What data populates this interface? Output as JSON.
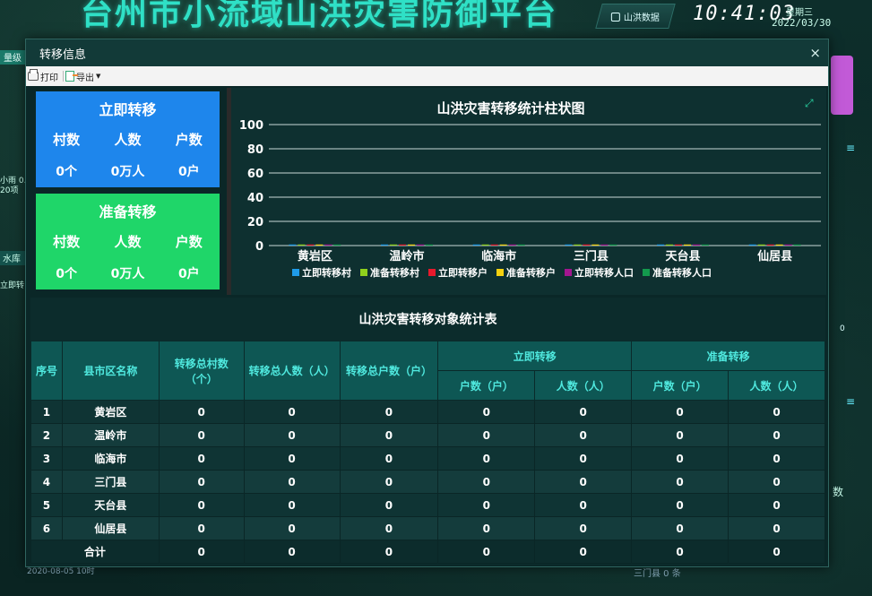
{
  "background": {
    "title": "台州市小流域山洪灾害防御平台",
    "data_tab": "山洪数据",
    "time": "10:41:03",
    "weekday": "星期三",
    "date": "2022/03/30",
    "left_tab_1": "量级",
    "left_text_line1": "小雨 0.",
    "left_text_line2": "20项",
    "left_tab_2": "水库",
    "left_text_3": "立即转",
    "right_zero": "0",
    "right_text": "数",
    "bottom_date": "2020-08-05 10时",
    "bottom_county": "三门县 0 条"
  },
  "modal": {
    "title": "转移信息",
    "close_label": "×",
    "toolbar": {
      "print": "打印",
      "export": "导出"
    }
  },
  "stats": {
    "immediate": {
      "title": "立即转移",
      "headers": [
        "村数",
        "人数",
        "户数"
      ],
      "values": [
        "0个",
        "0万人",
        "0户"
      ]
    },
    "prepare": {
      "title": "准备转移",
      "headers": [
        "村数",
        "人数",
        "户数"
      ],
      "values": [
        "0个",
        "0万人",
        "0户"
      ]
    }
  },
  "chart_data": {
    "type": "bar",
    "title": "山洪灾害转移统计柱状图",
    "categories": [
      "黄岩区",
      "温岭市",
      "临海市",
      "三门县",
      "天台县",
      "仙居县"
    ],
    "series": [
      {
        "name": "立即转移村",
        "color": "#1f9be8",
        "values": [
          0,
          0,
          0,
          0,
          0,
          0
        ]
      },
      {
        "name": "准备转移村",
        "color": "#8fd01c",
        "values": [
          0,
          0,
          0,
          0,
          0,
          0
        ]
      },
      {
        "name": "立即转移户",
        "color": "#e8192c",
        "values": [
          0,
          0,
          0,
          0,
          0,
          0
        ]
      },
      {
        "name": "准备转移户",
        "color": "#f5d10f",
        "values": [
          0,
          0,
          0,
          0,
          0,
          0
        ]
      },
      {
        "name": "立即转移人口",
        "color": "#a2168f",
        "values": [
          0,
          0,
          0,
          0,
          0,
          0
        ]
      },
      {
        "name": "准备转移人口",
        "color": "#139a4d",
        "values": [
          0,
          0,
          0,
          0,
          0,
          0
        ]
      }
    ],
    "ylim": [
      0,
      100
    ],
    "yticks": [
      0,
      20,
      40,
      60,
      80,
      100
    ],
    "grid": true,
    "legend_position": "bottom"
  },
  "table": {
    "title": "山洪灾害转移对象统计表",
    "headers": {
      "index": "序号",
      "county": "县市区名称",
      "total_villages": "转移总村数（个）",
      "total_people": "转移总人数（人）",
      "total_households": "转移总户数（户）",
      "immediate": "立即转移",
      "prepare": "准备转移",
      "households": "户数（户）",
      "people": "人数（人）"
    },
    "rows": [
      {
        "index": "1",
        "county": "黄岩区",
        "v": [
          "0",
          "0",
          "0",
          "0",
          "0",
          "0",
          "0"
        ]
      },
      {
        "index": "2",
        "county": "温岭市",
        "v": [
          "0",
          "0",
          "0",
          "0",
          "0",
          "0",
          "0"
        ]
      },
      {
        "index": "3",
        "county": "临海市",
        "v": [
          "0",
          "0",
          "0",
          "0",
          "0",
          "0",
          "0"
        ]
      },
      {
        "index": "4",
        "county": "三门县",
        "v": [
          "0",
          "0",
          "0",
          "0",
          "0",
          "0",
          "0"
        ]
      },
      {
        "index": "5",
        "county": "天台县",
        "v": [
          "0",
          "0",
          "0",
          "0",
          "0",
          "0",
          "0"
        ]
      },
      {
        "index": "6",
        "county": "仙居县",
        "v": [
          "0",
          "0",
          "0",
          "0",
          "0",
          "0",
          "0"
        ]
      }
    ],
    "total": {
      "label": "合计",
      "v": [
        "0",
        "0",
        "0",
        "0",
        "0",
        "0",
        "0"
      ]
    }
  }
}
